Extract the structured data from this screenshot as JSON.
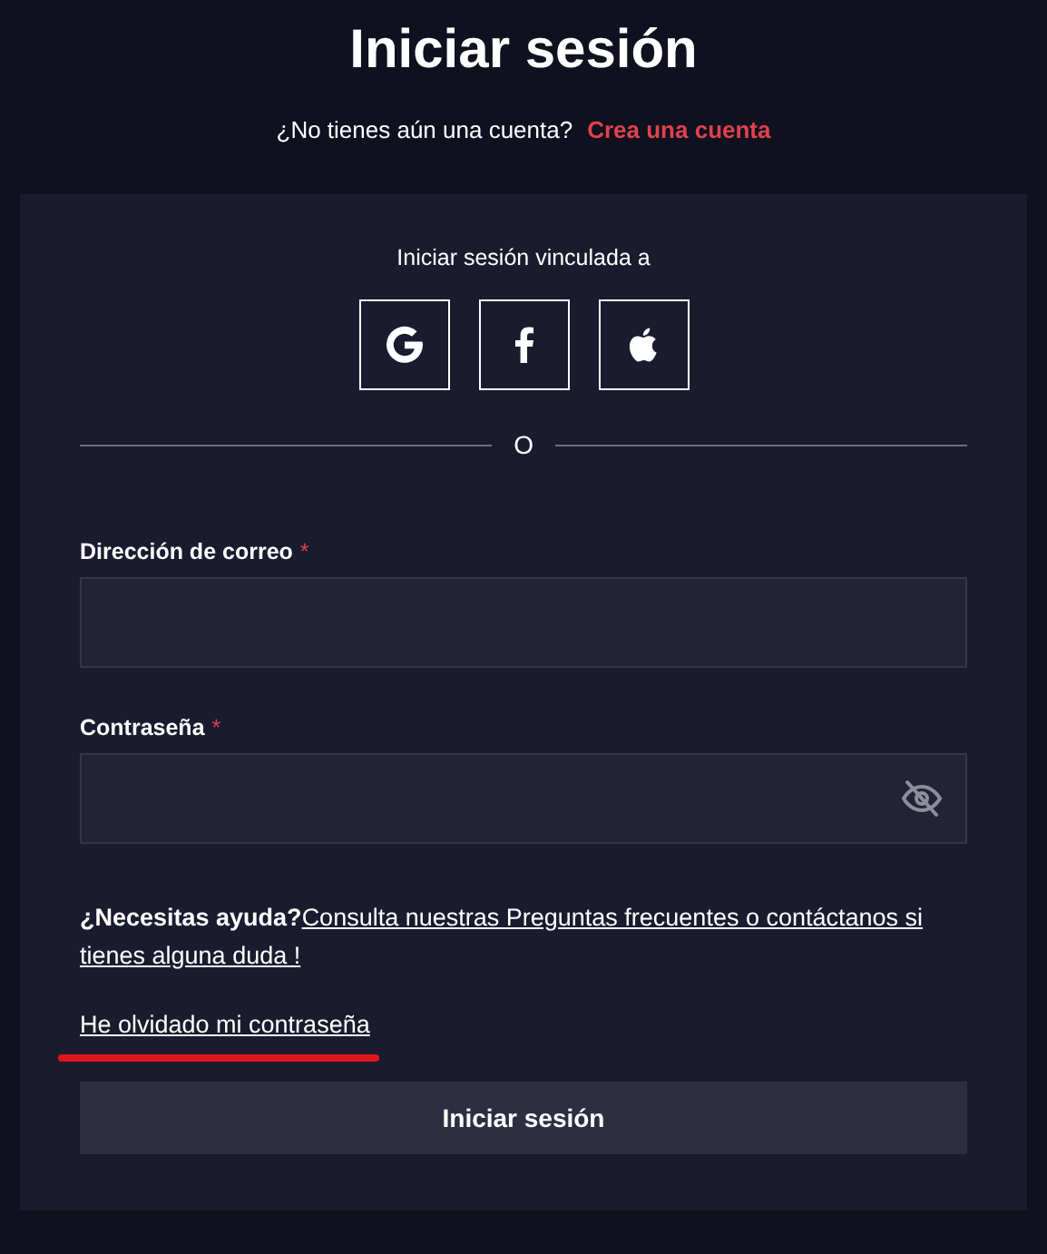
{
  "title": "Iniciar sesión",
  "signup": {
    "prompt": "¿No tienes aún una cuenta?",
    "link": "Crea una cuenta"
  },
  "social": {
    "label": "Iniciar sesión vinculada a",
    "providers": [
      {
        "kind": "google"
      },
      {
        "kind": "facebook"
      },
      {
        "kind": "apple"
      }
    ]
  },
  "divider": "O",
  "fields": [
    {
      "label": "Dirección de correo",
      "required_mark": "*"
    },
    {
      "label": "Contraseña",
      "required_mark": "*",
      "password_toggle": true
    }
  ],
  "help": {
    "label": "¿Necesitas ayuda?",
    "link": "Consulta nuestras Preguntas frecuentes o contáctanos si tienes alguna duda !"
  },
  "forgot": {
    "link": "He olvidado mi contraseña",
    "highlighted": true
  },
  "submit": "Iniciar sesión"
}
